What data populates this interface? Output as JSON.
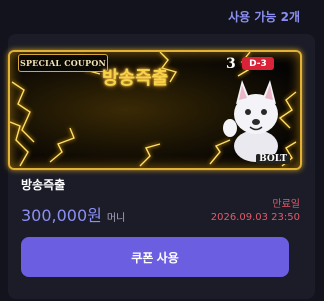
{
  "header": {
    "available_count": "사용 가능 2개"
  },
  "coupon": {
    "tag": "SPECIAL COUPON",
    "banner_title": "방송즉출",
    "brand_logo": "D-3",
    "brand_badge": "BOLT",
    "name": "방송즉출",
    "amount": "300,000원",
    "amount_unit": "머니",
    "expiry_label": "만료일",
    "expiry_date": "2026.09.03 23:50",
    "use_button_label": "쿠폰 사용"
  },
  "colors": {
    "accent": "#6b5ee0",
    "amount": "#8b8ff2",
    "expiry": "#e05a6a",
    "gold": "#e2b236"
  }
}
